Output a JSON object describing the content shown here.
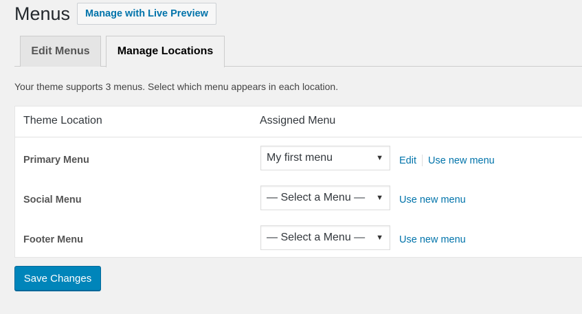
{
  "header": {
    "title": "Menus",
    "live_preview_label": "Manage with Live Preview"
  },
  "tabs": [
    {
      "label": "Edit Menus",
      "active": false
    },
    {
      "label": "Manage Locations",
      "active": true
    }
  ],
  "intro_text": "Your theme supports 3 menus. Select which menu appears in each location.",
  "table": {
    "col_location": "Theme Location",
    "col_menu": "Assigned Menu",
    "rows": [
      {
        "location": "Primary Menu",
        "selected": "My first menu",
        "edit_label": "Edit",
        "new_label": "Use new menu"
      },
      {
        "location": "Social Menu",
        "selected": "— Select a Menu —",
        "new_label": "Use new menu"
      },
      {
        "location": "Footer Menu",
        "selected": "— Select a Menu —",
        "new_label": "Use new menu"
      }
    ]
  },
  "save_label": "Save Changes",
  "icons": {
    "select_arrow": "▼"
  },
  "colors": {
    "link": "#0073aa",
    "primary_button": "#0085ba"
  }
}
